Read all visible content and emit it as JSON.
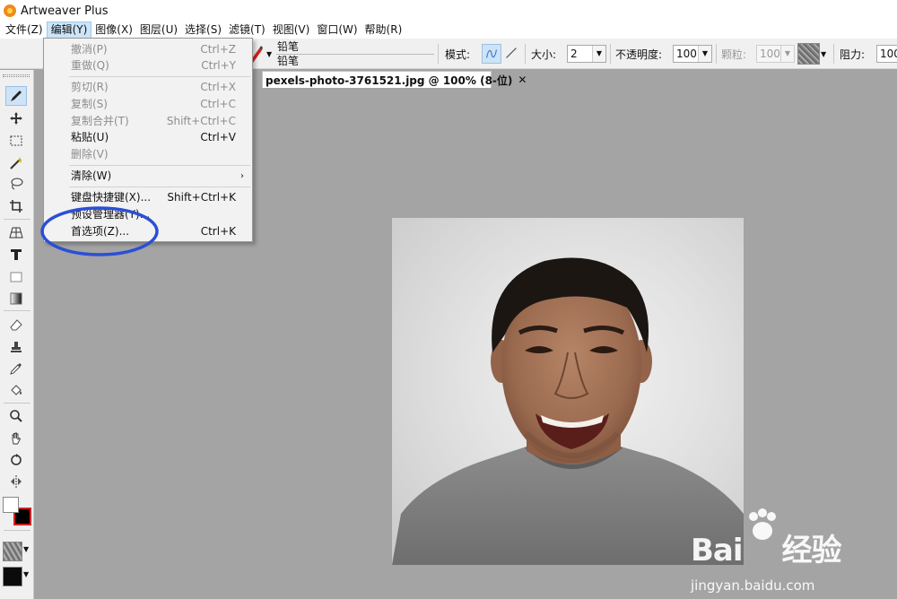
{
  "app": {
    "title": "Artweaver Plus"
  },
  "menubar": {
    "items": [
      "文件(Z)",
      "编辑(Y)",
      "图像(X)",
      "图层(U)",
      "选择(S)",
      "滤镜(T)",
      "视图(V)",
      "窗口(W)",
      "帮助(R)"
    ],
    "active_index": 1
  },
  "options_bar": {
    "brush_name_top": "铅笔",
    "brush_name_bottom": "铅笔",
    "mode_label": "模式:",
    "size_label": "大小:",
    "size_value": "2",
    "opacity_label": "不透明度:",
    "opacity_value": "100",
    "grain_label": "颗粒:",
    "grain_value": "100",
    "resist_label": "阻力:",
    "resist_value": "100"
  },
  "document": {
    "tab_label": "pexels-photo-3761521.jpg @ 100% (8-位)",
    "close_glyph": "✕"
  },
  "edit_menu": {
    "items": [
      {
        "label": "撤消(P)",
        "shortcut": "Ctrl+Z",
        "enabled": false
      },
      {
        "label": "重做(Q)",
        "shortcut": "Ctrl+Y",
        "enabled": false
      },
      {
        "label": "剪切(R)",
        "shortcut": "Ctrl+X",
        "enabled": false
      },
      {
        "label": "复制(S)",
        "shortcut": "Ctrl+C",
        "enabled": false
      },
      {
        "label": "复制合并(T)",
        "shortcut": "Shift+Ctrl+C",
        "enabled": false
      },
      {
        "label": "粘贴(U)",
        "shortcut": "Ctrl+V",
        "enabled": true
      },
      {
        "label": "删除(V)",
        "shortcut": "",
        "enabled": false
      },
      {
        "label": "清除(W)",
        "shortcut": "",
        "enabled": true,
        "submenu": true
      },
      {
        "label": "键盘快捷键(X)...",
        "shortcut": "Shift+Ctrl+K",
        "enabled": true
      },
      {
        "label": "预设管理器(Y)...",
        "shortcut": "",
        "enabled": true
      },
      {
        "label": "首选项(Z)...",
        "shortcut": "Ctrl+K",
        "enabled": true
      }
    ]
  },
  "annotation": {
    "color": "#2b4fd6",
    "target": "首选项(Z)..."
  },
  "watermark": {
    "brand": "Bai",
    "brand_cn": "经验",
    "url": "jingyan.baidu.com"
  },
  "colors": {
    "foreground": "#ffffff",
    "background": "#000000",
    "canvas_bg": "#a4a4a4",
    "menu_highlight": "#cce4f7"
  }
}
